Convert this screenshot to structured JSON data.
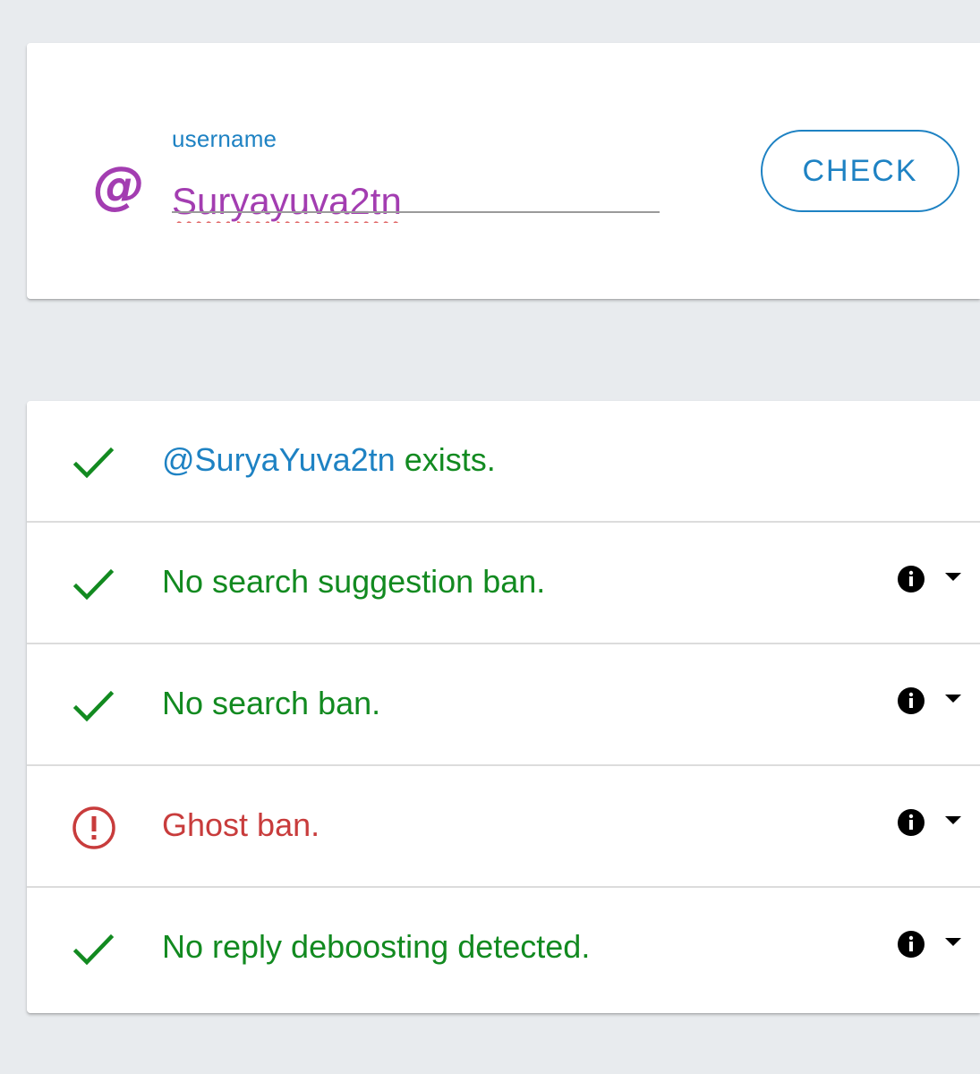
{
  "search": {
    "label": "username",
    "at_symbol": "@",
    "value": "Suryayuva2tn",
    "button_label": "CHECK"
  },
  "results": [
    {
      "status": "ok",
      "handle": "@SuryaYuva2tn",
      "text": " exists.",
      "has_info": false
    },
    {
      "status": "ok",
      "text": "No search suggestion ban.",
      "has_info": true
    },
    {
      "status": "ok",
      "text": "No search ban.",
      "has_info": true
    },
    {
      "status": "warn",
      "text": "Ghost ban.",
      "has_info": true
    },
    {
      "status": "ok",
      "text": "No reply deboosting detected.",
      "has_info": true
    }
  ],
  "colors": {
    "accent_blue": "#1e82c3",
    "username_purple": "#a33db1",
    "ok_green": "#128a20",
    "warn_red": "#c83c3c",
    "background": "#e8ebee"
  },
  "icons": {
    "ok": "checkmark-icon",
    "warn": "exclamation-circle-icon",
    "info": "info-icon",
    "expand": "caret-down-icon"
  }
}
